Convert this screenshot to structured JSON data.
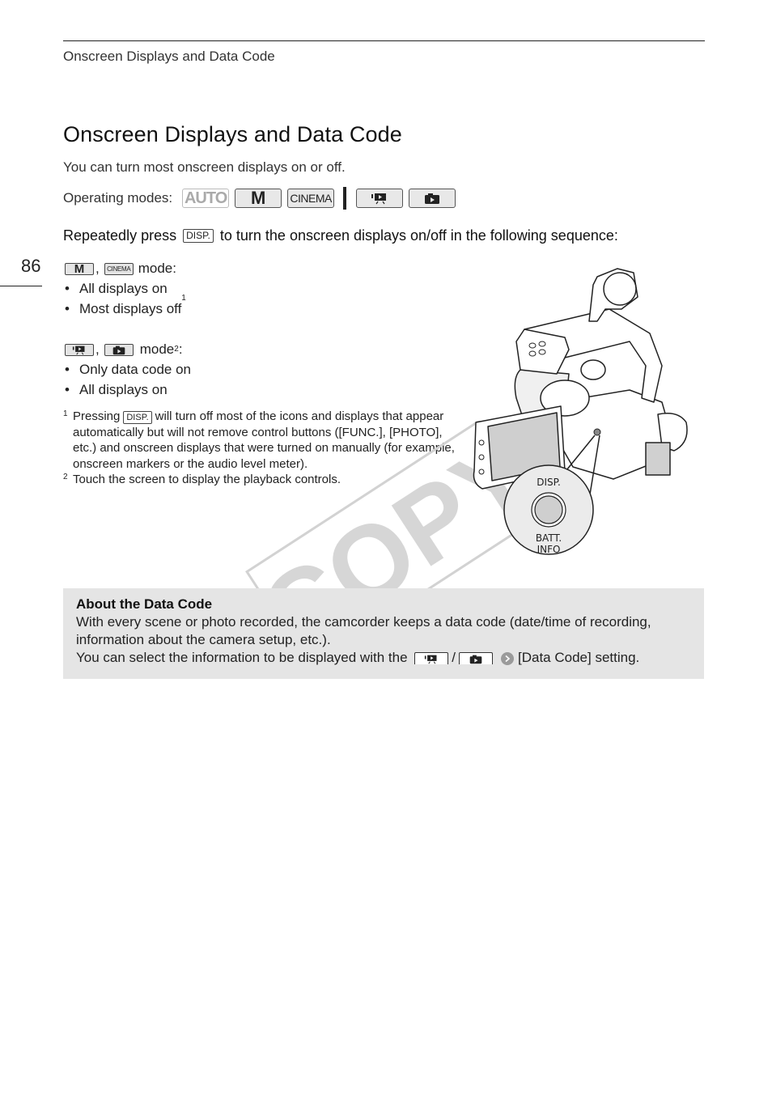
{
  "running_head": "Onscreen Displays and Data Code",
  "page_number": "86",
  "title": "Onscreen Displays and Data Code",
  "intro": "You can turn most onscreen displays on or off.",
  "operating_modes": {
    "label": "Operating modes:",
    "modes": [
      {
        "label": "AUTO",
        "state": "inactive"
      },
      {
        "label": "M",
        "state": "active"
      },
      {
        "label": "CINEMA",
        "state": "active"
      },
      {
        "icon": "movie-playback-icon",
        "state": "active"
      },
      {
        "icon": "photo-playback-icon",
        "state": "active"
      }
    ]
  },
  "instruction": {
    "before": "Repeatedly press",
    "key": "DISP.",
    "after": "to turn the onscreen displays on/off in the following sequence:"
  },
  "recording_modes": {
    "badge_m": "M",
    "badge_cinema": "CINEMA",
    "separator": ",",
    "suffix": "mode:",
    "items": [
      "All displays on",
      "Most displays off"
    ],
    "item2_footnote": "1"
  },
  "playback_modes": {
    "separator": ",",
    "suffix": "mode",
    "footnote": "2",
    "colon": ":",
    "items": [
      "Only data code on",
      "All displays on"
    ]
  },
  "footnotes": [
    {
      "num": "1",
      "before": "Pressing",
      "key": "DISP.",
      "after": "will turn off most of the icons and displays that appear automatically but will not remove control buttons ([FUNC.], [PHOTO], etc.) and onscreen displays that were turned on manually (for example, onscreen markers or the audio level meter)."
    },
    {
      "num": "2",
      "text": "Touch the screen to display the playback controls."
    }
  ],
  "illustration": {
    "callout_top": "DISP.",
    "callout_bottom_1": "BATT.",
    "callout_bottom_2": "INFO"
  },
  "watermark": "COPY",
  "data_code_box": {
    "heading": "About the Data Code",
    "line1": "With every scene or photo recorded, the camcorder keeps a data code (date/time of recording, information about the camera setup, etc.).",
    "line2_before": "You can select the information to be displayed with the",
    "slash": "/",
    "line2_after": "[Data Code] setting."
  },
  "colors": {
    "box_background": "#e5e5e5",
    "text": "#222222",
    "watermark": "#cccccc"
  }
}
